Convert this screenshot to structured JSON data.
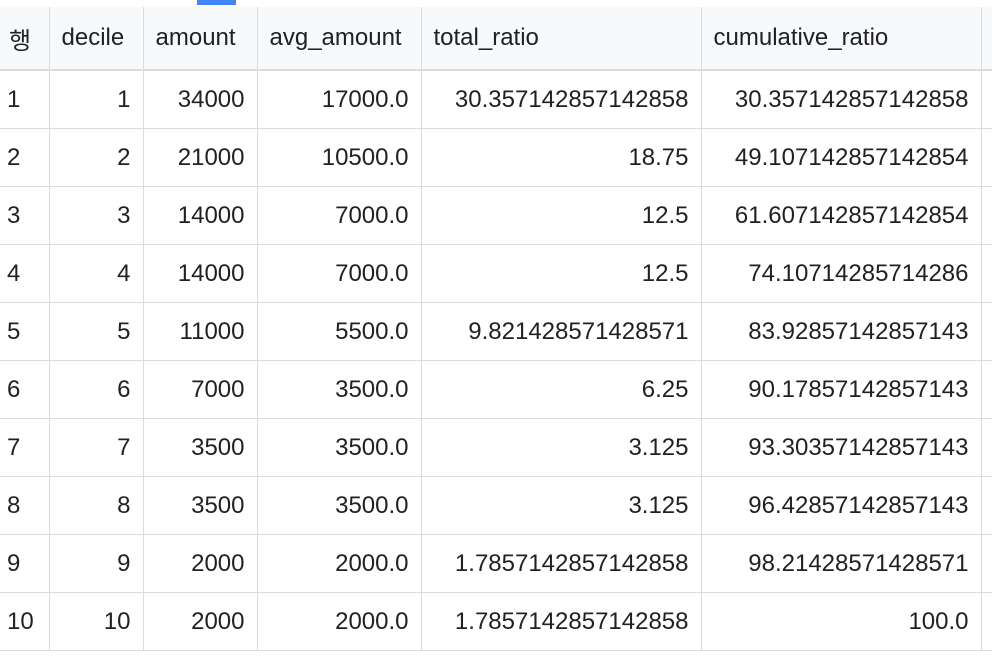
{
  "columns": [
    {
      "key": "row",
      "label": "행"
    },
    {
      "key": "decile",
      "label": "decile"
    },
    {
      "key": "amount",
      "label": "amount"
    },
    {
      "key": "avg_amount",
      "label": "avg_amount"
    },
    {
      "key": "total_ratio",
      "label": "total_ratio"
    },
    {
      "key": "cumulative_ratio",
      "label": "cumulative_ratio"
    }
  ],
  "rows": [
    [
      "1",
      "1",
      "34000",
      "17000.0",
      "30.357142857142858",
      "30.357142857142858"
    ],
    [
      "2",
      "2",
      "21000",
      "10500.0",
      "18.75",
      "49.107142857142854"
    ],
    [
      "3",
      "3",
      "14000",
      "7000.0",
      "12.5",
      "61.607142857142854"
    ],
    [
      "4",
      "4",
      "14000",
      "7000.0",
      "12.5",
      "74.10714285714286"
    ],
    [
      "5",
      "5",
      "11000",
      "5500.0",
      "9.821428571428571",
      "83.92857142857143"
    ],
    [
      "6",
      "6",
      "7000",
      "3500.0",
      "6.25",
      "90.17857142857143"
    ],
    [
      "7",
      "7",
      "3500",
      "3500.0",
      "3.125",
      "93.30357142857143"
    ],
    [
      "8",
      "8",
      "3500",
      "3500.0",
      "3.125",
      "96.42857142857143"
    ],
    [
      "9",
      "9",
      "2000",
      "2000.0",
      "1.7857142857142858",
      "98.21428571428571"
    ],
    [
      "10",
      "10",
      "2000",
      "2000.0",
      "1.7857142857142858",
      "100.0"
    ]
  ],
  "colors": {
    "accent": "#4285f4",
    "border": "#dadce0",
    "header_bg": "#f8f9fa",
    "text": "#202124"
  }
}
